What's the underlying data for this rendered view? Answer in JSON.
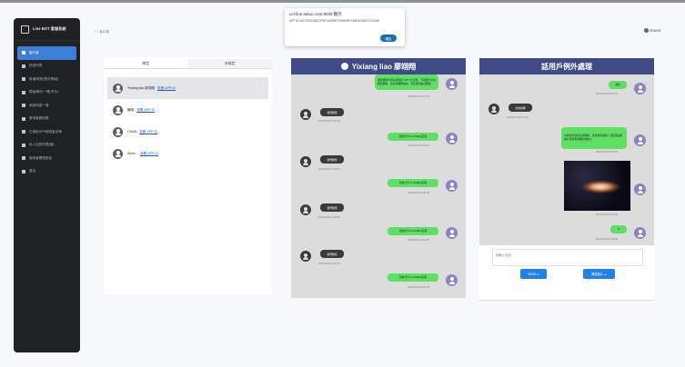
{
  "sidebar": {
    "brand": "Line BOT 客服系統",
    "items": [
      {
        "label": "客戶頁",
        "active": true
      },
      {
        "label": "訊息列表"
      },
      {
        "label": "新增/修改(對外群組)"
      },
      {
        "label": "群組/聊天一覽(不分)"
      },
      {
        "label": "系統訊息一覽"
      },
      {
        "label": "常用客服回覆"
      },
      {
        "label": "已綁定APP使用者名單"
      },
      {
        "label": "私人交談列表(個)"
      },
      {
        "label": "使用者權限設定"
      },
      {
        "label": "登出"
      }
    ]
  },
  "breadcrumb": "⌂ / 客戶頁",
  "guest": "Guest",
  "popup": {
    "title": "ucl-line.lebuo.com:8000 顯示",
    "sub": "APP ID: 6CC909C4BCDF9F7A8599F149909B7418E50250D7121056",
    "ok": "確定"
  },
  "tabs": [
    "綁定",
    "未綁定"
  ],
  "users": [
    {
      "name": "Yixiang liao 廖翊翔",
      "link": "查看 APP ID",
      "active": true
    },
    {
      "name": "陳翊",
      "link": "查看 APP ID"
    },
    {
      "name": "CHAN",
      "link": "查看 APP ID"
    },
    {
      "name": "Zhen^-",
      "link": "查看 APP ID"
    }
  ],
  "chat_a": {
    "title": "Yixiang liao 廖翊翔",
    "messages": [
      {
        "side": "right",
        "text": "邊緣備援外部系統連結 APP 持 打掃，下報至於平台做回應時，避免重複聯絡每，有任擬何事此聯絡",
        "time": "2024-08-30 16:17:51"
      },
      {
        "side": "left",
        "text": "我們簡單",
        "time": "2024-08-30 12:15:19"
      },
      {
        "side": "right",
        "text": "週末分享 & ChatBot回報",
        "time": "2024-09-04 11:59:44"
      },
      {
        "side": "left",
        "text": "我們簡單",
        "time": "2024-09-04 13:16:12"
      },
      {
        "side": "right",
        "text": "週末分享 & ChatBot回報",
        "time": "2024-09-04 13:31:22"
      },
      {
        "side": "left",
        "text": "我們簡單",
        "time": "2024-09-04 13:16:12"
      },
      {
        "side": "right",
        "text": "週末分享 & ChatBot回報",
        "time": "2024-09-04 14:02:25"
      },
      {
        "side": "left",
        "text": "我們簡單",
        "time": "2024-09-04 13:16:12"
      },
      {
        "side": "right",
        "text": "週末分享 & ChatBot回報",
        "time": "2024-09-04 16:02:30"
      }
    ]
  },
  "chat_b": {
    "title": "話用戶例外處理",
    "messages": [
      {
        "side": "right",
        "text": "測試",
        "time": "2024-09-10 15:34:21"
      },
      {
        "side": "left",
        "text": "請求處理",
        "time": "2024-09-10 11:21:04"
      },
      {
        "side": "right",
        "text": "分析處外部訊息處理時，請查看何處看！請回測試用圖片資料庫處理的判斷之",
        "time": "2024-09-10 13:53:07"
      },
      {
        "side": "right",
        "text": "",
        "time": "2024-09-10 11:03:35",
        "image": true
      },
      {
        "side": "right",
        "text": "hi",
        "time": "2024-09-10 11:03:38"
      }
    ],
    "input_placeholder": "請輸入訊息",
    "send": "SEND",
    "upload": "傳送圖片"
  }
}
